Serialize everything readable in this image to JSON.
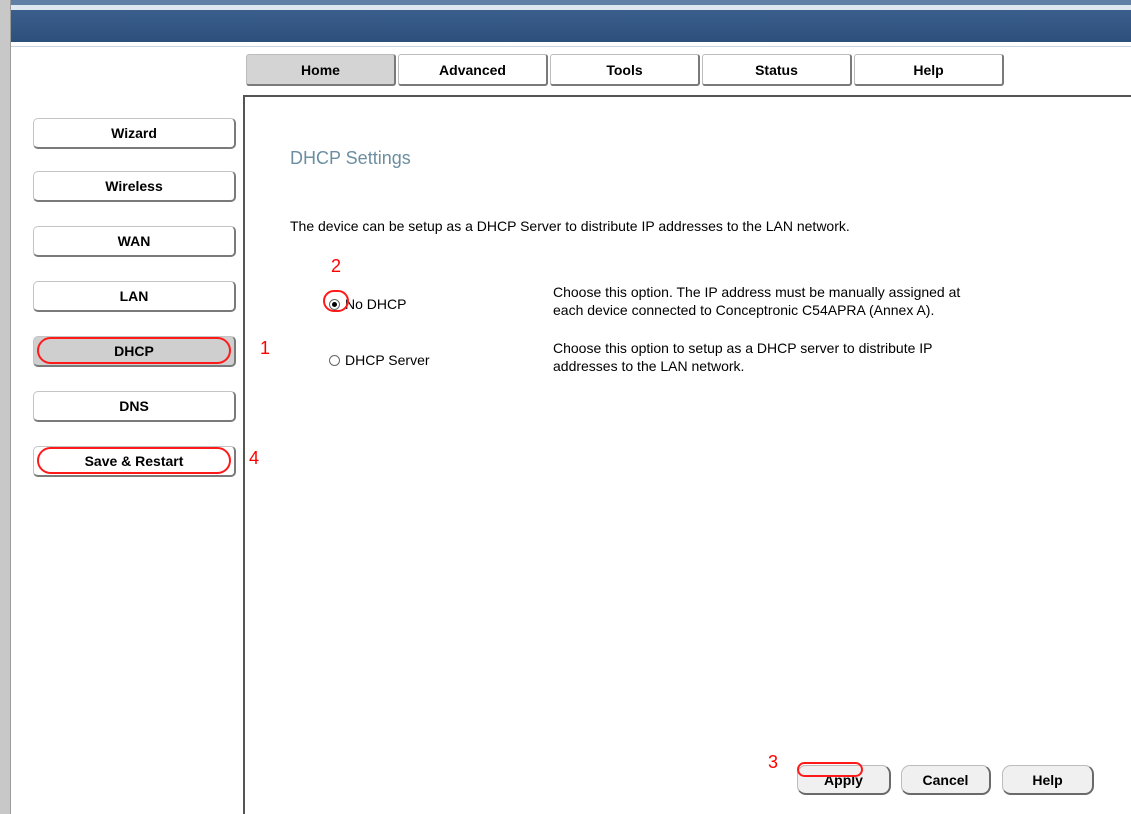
{
  "top_tabs": [
    "Home",
    "Advanced",
    "Tools",
    "Status",
    "Help"
  ],
  "active_tab": "Home",
  "sidebar": {
    "items": [
      "Wizard",
      "Wireless",
      "WAN",
      "LAN",
      "DHCP",
      "DNS",
      "Save & Restart"
    ],
    "active": "DHCP"
  },
  "page": {
    "title": "DHCP Settings",
    "intro": "The device can be setup as a DHCP Server to distribute IP addresses to the LAN network."
  },
  "options": [
    {
      "label": "No DHCP",
      "checked": true,
      "description_line1": "Choose this option. The IP address must be manually assigned at",
      "description_line2": "each device connected to Conceptronic C54APRA (Annex A)."
    },
    {
      "label": "DHCP Server",
      "checked": false,
      "description_line1": "Choose this option to setup as a DHCP server to distribute IP",
      "description_line2": "addresses to the LAN network."
    }
  ],
  "buttons": {
    "apply": "Apply",
    "cancel": "Cancel",
    "help": "Help"
  },
  "annotations": {
    "step1": "1",
    "step2": "2",
    "step3": "3",
    "step4": "4"
  },
  "colors": {
    "annotation": "#ff0000",
    "title": "#6c8ea0",
    "banner": "#2c4f7c"
  }
}
